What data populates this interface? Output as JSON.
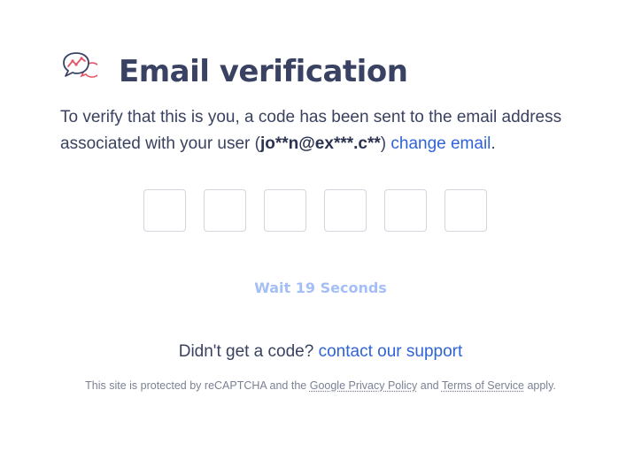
{
  "logo": {
    "icon": "chat-chart-icon"
  },
  "title": "Email verification",
  "description": {
    "before": "To verify that this is you, a code has been sent to the email address associated with your user (",
    "email": "jo**n@ex***.c**",
    "after": ") ",
    "change_link": "change email",
    "end": "."
  },
  "code_inputs": [
    {
      "value": ""
    },
    {
      "value": ""
    },
    {
      "value": ""
    },
    {
      "value": ""
    },
    {
      "value": ""
    },
    {
      "value": ""
    }
  ],
  "wait_button": "Wait 19 Seconds",
  "support": {
    "prompt": "Didn't get a code? ",
    "link": "contact our support"
  },
  "recaptcha": {
    "before": "This site is protected by reCAPTCHA and the ",
    "privacy_link": "Google Privacy Policy",
    "middle": " and ",
    "terms_link": "Terms of Service",
    "after": " apply."
  },
  "colors": {
    "title": "#3a4263",
    "link": "#2f63d8",
    "wait_disabled": "#a4bef7",
    "logo_accent": "#e2566a",
    "logo_outline": "#3a4263"
  }
}
